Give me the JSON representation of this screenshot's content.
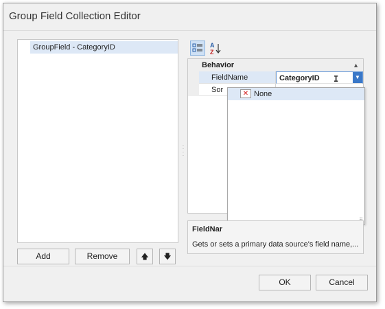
{
  "window": {
    "title": "Group Field Collection Editor"
  },
  "collection": {
    "items": [
      {
        "label": "GroupField - CategoryID",
        "selected": true
      }
    ]
  },
  "list_buttons": {
    "add_label": "Add",
    "remove_label": "Remove",
    "move_up_icon": "arrow-up-icon",
    "move_down_icon": "arrow-down-icon"
  },
  "property_grid": {
    "toolbar": {
      "categorized_icon": "categorized-icon",
      "alphabetical_icon": "sort-az-icon",
      "alphabetical_label": "A Z"
    },
    "category": {
      "label": "Behavior",
      "collapse_glyph": "▲"
    },
    "rows": [
      {
        "name": "FieldName",
        "value": "CategoryID",
        "selected": true
      },
      {
        "name": "Sor",
        "value": ""
      }
    ],
    "dropdown": {
      "items": [
        {
          "label": "None",
          "icon": "none-icon",
          "selected": true
        }
      ]
    }
  },
  "description": {
    "title": "FieldNar",
    "text": "Gets or sets a primary data source's field name,..."
  },
  "footer": {
    "ok_label": "OK",
    "cancel_label": "Cancel"
  },
  "colors": {
    "dialog_bg": "#f0f0f0",
    "selection": "#dde8f6",
    "accent": "#3a78c8",
    "none_icon": "#d42020"
  }
}
